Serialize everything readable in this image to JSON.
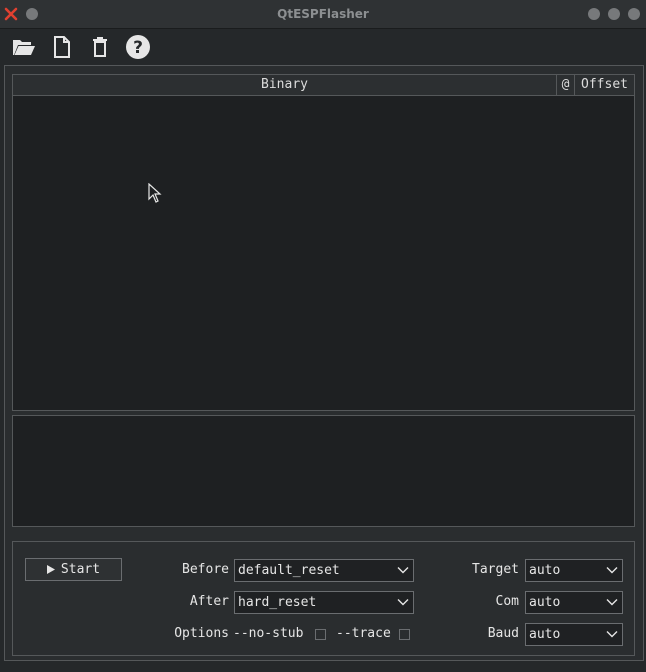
{
  "window": {
    "title": "QtESPFlasher"
  },
  "toolbar": {
    "open_icon": "folder-open-icon",
    "new_icon": "new-file-icon",
    "delete_icon": "trash-icon",
    "help_icon": "help-icon"
  },
  "table": {
    "columns": [
      {
        "label": "Binary"
      },
      {
        "label": "@"
      },
      {
        "label": "Offset"
      }
    ]
  },
  "controls": {
    "start_label": "Start",
    "before_label": "Before",
    "before_value": "default_reset",
    "after_label": "After",
    "after_value": "hard_reset",
    "options_label": "Options",
    "no_stub_label": "--no-stub",
    "trace_label": "--trace",
    "target_label": "Target",
    "target_value": "auto",
    "com_label": "Com",
    "com_value": "auto",
    "baud_label": "Baud",
    "baud_value": "auto"
  },
  "colors": {
    "close": "#e04030",
    "background": "#25282a",
    "border": "#55585a"
  }
}
